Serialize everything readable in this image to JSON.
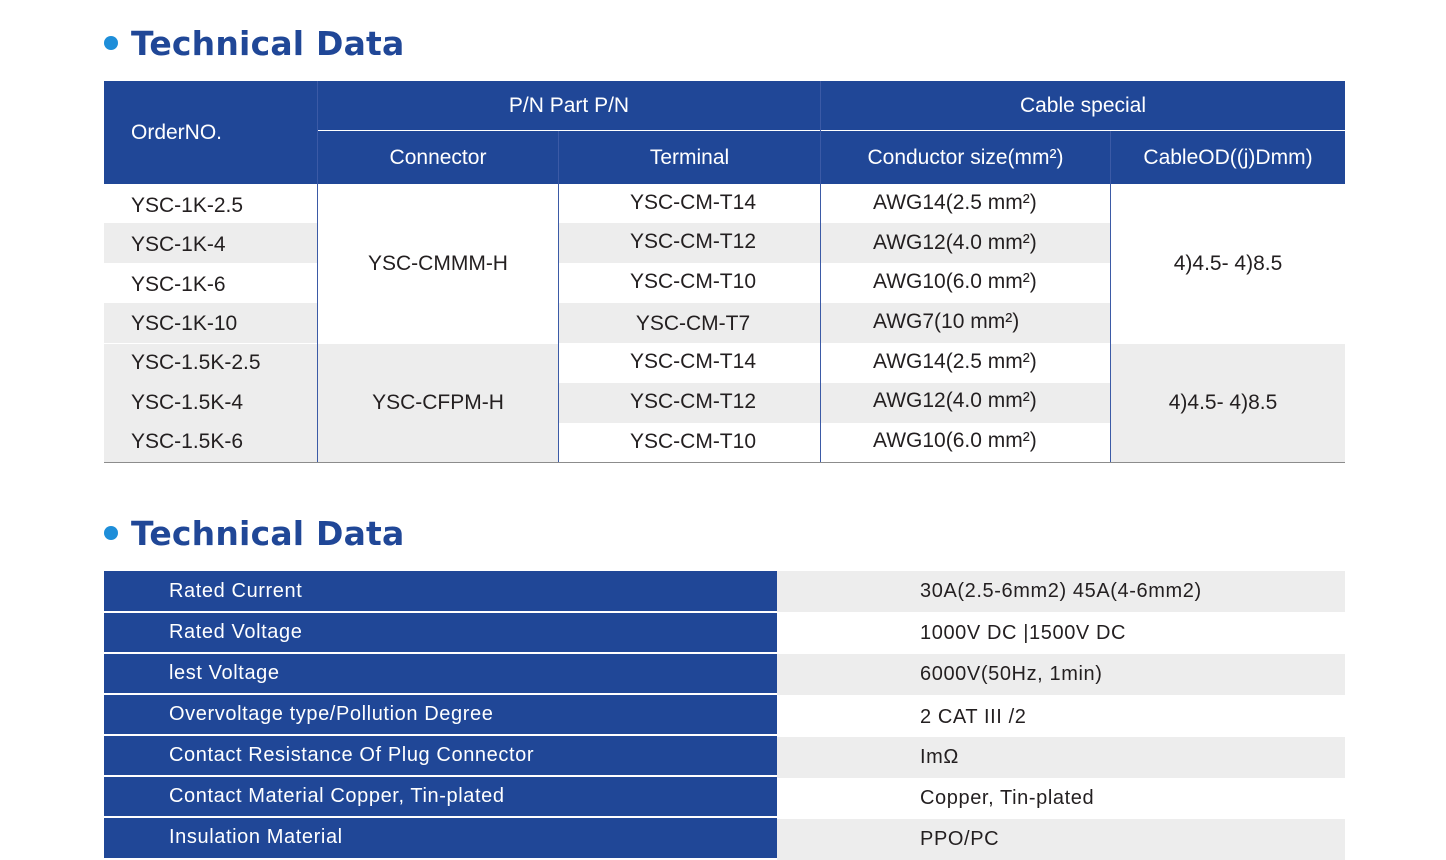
{
  "section1": {
    "title": "Technical Data"
  },
  "section2": {
    "title": "Technical Data"
  },
  "table1": {
    "headers": {
      "order_no": "OrderNO.",
      "pn_group": "P/N Part P/N",
      "connector": "Connector",
      "terminal": "Terminal",
      "cable_group": "Cable special",
      "conductor": "Conductor size(mm²)",
      "cable_od": "CableOD((j)Dmm)"
    },
    "rows": [
      {
        "order": "YSC-1K-2.5",
        "terminal": "YSC-CM-T14",
        "conductor": "AWG14(2.5 mm²)"
      },
      {
        "order": "YSC-1K-4",
        "terminal": "YSC-CM-T12",
        "conductor": "AWG12(4.0 mm²)"
      },
      {
        "order": "YSC-1K-6",
        "terminal": "YSC-CM-T10",
        "conductor": "AWG10(6.0 mm²)"
      },
      {
        "order": "YSC-1K-10",
        "terminal": "YSC-CM-T7",
        "conductor": "AWG7(10 mm²)"
      },
      {
        "order": "YSC-1.5K-2.5",
        "terminal": "YSC-CM-T14",
        "conductor": "AWG14(2.5 mm²)"
      },
      {
        "order": "YSC-1.5K-4",
        "terminal": "YSC-CM-T12",
        "conductor": "AWG12(4.0 mm²)"
      },
      {
        "order": "YSC-1.5K-6",
        "terminal": "YSC-CM-T10",
        "conductor": "AWG10(6.0 mm²)"
      }
    ],
    "groups": [
      {
        "connector": "YSC-CMMM-H",
        "cable_od": "4)4.5- 4)8.5"
      },
      {
        "connector": "YSC-CFPM-H",
        "cable_od": "4)4.5- 4)8.5"
      }
    ]
  },
  "table2": {
    "rows": [
      {
        "label": "Rated Current",
        "value": "30A(2.5-6mm2) 45A(4-6mm2)"
      },
      {
        "label": "Rated Voltage",
        "value": "1000V DC |1500V DC"
      },
      {
        "label": "lest Voltage",
        "value": "6000V(50Hz, 1min)"
      },
      {
        "label": "Overvoltage type/Pollution Degree",
        "value": "2 CAT III /2"
      },
      {
        "label": "Contact Resistance Of Plug Connector",
        "value": "ImΩ"
      },
      {
        "label": "Contact Material Copper, Tin-plated",
        "value": "Copper, Tin-plated"
      },
      {
        "label": "Insulation Material",
        "value": "PPO/PC"
      }
    ]
  }
}
